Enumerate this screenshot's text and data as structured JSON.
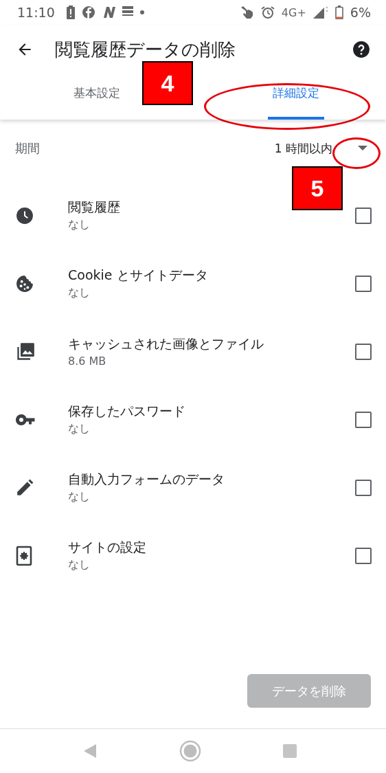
{
  "status_bar": {
    "time": "11:10",
    "network": "4G+",
    "battery": "6%"
  },
  "header": {
    "title": "閲覧履歴データの削除"
  },
  "tabs": [
    {
      "label": "基本設定",
      "selected": false
    },
    {
      "label": "詳細設定",
      "selected": true
    }
  ],
  "period": {
    "label": "期間",
    "value": "1 時間以内"
  },
  "items": [
    {
      "kind": "clock",
      "title": "閲覧履歴",
      "subtitle": "なし",
      "checked": false
    },
    {
      "kind": "cookie",
      "title": "Cookie とサイトデータ",
      "subtitle": "なし",
      "checked": false
    },
    {
      "kind": "images",
      "title": "キャッシュされた画像とファイル",
      "subtitle": "8.6 MB",
      "checked": false
    },
    {
      "kind": "key",
      "title": "保存したパスワード",
      "subtitle": "なし",
      "checked": false
    },
    {
      "kind": "pencil",
      "title": "自動入力フォームのデータ",
      "subtitle": "なし",
      "checked": false
    },
    {
      "kind": "site-settings",
      "title": "サイトの設定",
      "subtitle": "なし",
      "checked": false
    }
  ],
  "delete_button": {
    "label": "データを削除",
    "disabled": true
  },
  "callouts": [
    {
      "label": "4"
    },
    {
      "label": "5"
    }
  ]
}
